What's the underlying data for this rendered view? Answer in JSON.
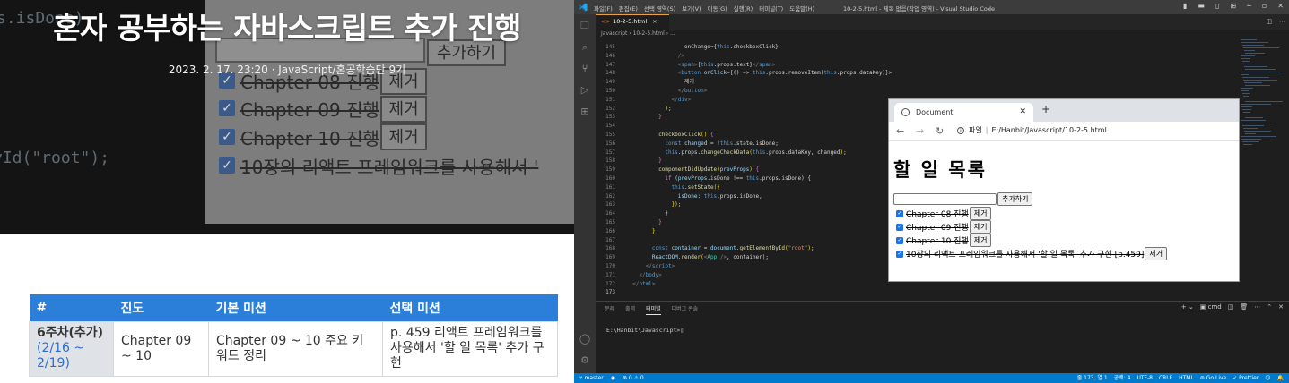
{
  "blog": {
    "title": "혼자 공부하는 자바스크립트 추가 진행",
    "meta": "2023. 2. 17. 23:20 · JavaScript/혼공학습단 9기",
    "hero_bg": {
      "code_line1": "s.isDone)",
      "code_line2": "yId(\"root\");",
      "add_button": "추가하기",
      "remove_button": "제거",
      "items": [
        "Chapter 08 진행",
        "Chapter 09 진행",
        "Chapter 10 진행",
        "10장의 리액트 프레임워크를 사용해서 '"
      ]
    },
    "table": {
      "headers": [
        "#",
        "진도",
        "기본 미션",
        "선택 미션"
      ],
      "row": {
        "week": "6주차(추가)",
        "dates": "(2/16 ~ 2/19)",
        "progress": "Chapter 09 ~ 10",
        "basic_mission": "Chapter 09 ~ 10 주요 키워드 정리",
        "optional_mission": "p. 459 리액트 프레임워크를 사용해서 '할 일 목록' 추가 구현"
      }
    }
  },
  "vscode": {
    "menu": [
      "파일(F)",
      "편집(E)",
      "선택 영역(S)",
      "보기(V)",
      "이동(G)",
      "실행(R)",
      "터미널(T)",
      "도움말(H)"
    ],
    "window_title": "10-2-5.html - 제목 없음(작업 영역) - Visual Studio Code",
    "tab": {
      "label": "10-2-5.html",
      "close": "×"
    },
    "breadcrumb": "Javascript  ›  10-2-5.html  ›  ...",
    "code_lines": [
      {
        "n": "145",
        "segs": [
          [
            "p",
            "                  onChange={"
          ],
          [
            "k",
            "this"
          ],
          [
            "p",
            ".checkboxClick}"
          ]
        ]
      },
      {
        "n": "146",
        "segs": [
          [
            "gr",
            "                />"
          ]
        ]
      },
      {
        "n": "147",
        "segs": [
          [
            "gr",
            "                <"
          ],
          [
            "tg",
            "span"
          ],
          [
            "gr",
            ">"
          ],
          [
            "p",
            "{"
          ],
          [
            "k",
            "this"
          ],
          [
            "p",
            ".props.text}"
          ],
          [
            "gr",
            "</"
          ],
          [
            "tg",
            "span"
          ],
          [
            "gr",
            ">"
          ]
        ]
      },
      {
        "n": "148",
        "segs": [
          [
            "gr",
            "                <"
          ],
          [
            "tg",
            "button"
          ],
          [
            "v",
            " onClick"
          ],
          [
            "p",
            "={() => "
          ],
          [
            "k",
            "this"
          ],
          [
            "p",
            ".props.removeItem("
          ],
          [
            "k",
            "this"
          ],
          [
            "p",
            ".props.dataKey)}>"
          ]
        ]
      },
      {
        "n": "149",
        "segs": [
          [
            "p",
            "                  제거"
          ]
        ]
      },
      {
        "n": "150",
        "segs": [
          [
            "gr",
            "                </"
          ],
          [
            "tg",
            "button"
          ],
          [
            "gr",
            ">"
          ]
        ]
      },
      {
        "n": "151",
        "segs": [
          [
            "gr",
            "              </"
          ],
          [
            "tg",
            "div"
          ],
          [
            "gr",
            ">"
          ]
        ]
      },
      {
        "n": "152",
        "segs": [
          [
            "b",
            "            )"
          ],
          [
            "p",
            ";"
          ]
        ]
      },
      {
        "n": "153",
        "segs": [
          [
            "bb",
            "          }"
          ]
        ]
      },
      {
        "n": "154",
        "segs": [
          [
            "p",
            ""
          ]
        ]
      },
      {
        "n": "155",
        "segs": [
          [
            "f",
            "          checkboxClick"
          ],
          [
            "b",
            "()"
          ],
          [
            "p",
            " "
          ],
          [
            "bb",
            "{"
          ]
        ]
      },
      {
        "n": "156",
        "segs": [
          [
            "k",
            "            const"
          ],
          [
            "v",
            " changed"
          ],
          [
            "p",
            " = !"
          ],
          [
            "k",
            "this"
          ],
          [
            "p",
            ".state.isDone;"
          ]
        ]
      },
      {
        "n": "157",
        "segs": [
          [
            "k",
            "            this"
          ],
          [
            "p",
            ".props."
          ],
          [
            "f",
            "changeCheckData"
          ],
          [
            "b",
            "("
          ],
          [
            "k",
            "this"
          ],
          [
            "p",
            ".props.dataKey, changed"
          ],
          [
            "b",
            ")"
          ],
          [
            "p",
            ";"
          ]
        ]
      },
      {
        "n": "158",
        "segs": [
          [
            "bb",
            "          }"
          ]
        ]
      },
      {
        "n": "159",
        "segs": [
          [
            "f",
            "          componentDidUpdate"
          ],
          [
            "b",
            "("
          ],
          [
            "v",
            "prevProps"
          ],
          [
            "b",
            ")"
          ],
          [
            "p",
            " "
          ],
          [
            "bb",
            "{"
          ]
        ]
      },
      {
        "n": "160",
        "segs": [
          [
            "c",
            "            if"
          ],
          [
            "p",
            " ("
          ],
          [
            "v",
            "prevProps"
          ],
          [
            "p",
            ".isDone !== "
          ],
          [
            "k",
            "this"
          ],
          [
            "p",
            ".props.isDone) {"
          ]
        ]
      },
      {
        "n": "161",
        "segs": [
          [
            "k",
            "              this"
          ],
          [
            "p",
            "."
          ],
          [
            "f",
            "setState"
          ],
          [
            "b",
            "({"
          ]
        ]
      },
      {
        "n": "162",
        "segs": [
          [
            "v",
            "                isDone"
          ],
          [
            "p",
            ": "
          ],
          [
            "k",
            "this"
          ],
          [
            "p",
            ".props.isDone,"
          ]
        ]
      },
      {
        "n": "163",
        "segs": [
          [
            "b",
            "              })"
          ],
          [
            "p",
            ";"
          ]
        ]
      },
      {
        "n": "164",
        "segs": [
          [
            "p",
            "            }"
          ]
        ]
      },
      {
        "n": "165",
        "segs": [
          [
            "bb",
            "          }"
          ]
        ]
      },
      {
        "n": "166",
        "segs": [
          [
            "b",
            "        }"
          ]
        ]
      },
      {
        "n": "167",
        "segs": [
          [
            "p",
            ""
          ]
        ]
      },
      {
        "n": "168",
        "segs": [
          [
            "k",
            "        const"
          ],
          [
            "v",
            " container"
          ],
          [
            "p",
            " = "
          ],
          [
            "v",
            "document"
          ],
          [
            "p",
            "."
          ],
          [
            "f",
            "getElementById"
          ],
          [
            "b",
            "("
          ],
          [
            "s",
            "\"root\""
          ],
          [
            "b",
            ")"
          ],
          [
            "p",
            ";"
          ]
        ]
      },
      {
        "n": "169",
        "segs": [
          [
            "v",
            "        ReactDOM"
          ],
          [
            "p",
            "."
          ],
          [
            "f",
            "render"
          ],
          [
            "b",
            "("
          ],
          [
            "gr",
            "<"
          ],
          [
            "t",
            "App"
          ],
          [
            "gr",
            " />"
          ],
          [
            "p",
            ", container"
          ],
          [
            "b",
            ")"
          ],
          [
            "p",
            ";"
          ]
        ]
      },
      {
        "n": "170",
        "segs": [
          [
            "gr",
            "      </"
          ],
          [
            "tg",
            "script"
          ],
          [
            "gr",
            ">"
          ]
        ]
      },
      {
        "n": "171",
        "segs": [
          [
            "gr",
            "    </"
          ],
          [
            "tg",
            "body"
          ],
          [
            "gr",
            ">"
          ]
        ]
      },
      {
        "n": "172",
        "segs": [
          [
            "gr",
            "  </"
          ],
          [
            "tg",
            "html"
          ],
          [
            "gr",
            ">"
          ]
        ]
      },
      {
        "n": "173",
        "segs": [
          [
            "p",
            ""
          ]
        ]
      }
    ],
    "panel": {
      "tabs": [
        "문제",
        "출력",
        "터미널",
        "디버그 콘솔"
      ],
      "active_tab": 2,
      "shell": "cmd",
      "terminal_text": "E:\\Hanbit\\Javascript>"
    },
    "status": {
      "branch": "master",
      "errors": "⊗ 0  ⚠ 0",
      "position": "줄 173, 열 1",
      "spaces": "공백: 4",
      "encoding": "UTF-8",
      "eol": "CRLF",
      "language": "HTML",
      "golive": "Go Live",
      "prettier": "✓ Prettier"
    }
  },
  "browser": {
    "tab_title": "Document",
    "url_scheme": "파일",
    "url_path": "E:/Hanbit/Javascript/10-2-5.html",
    "heading": "할 일 목록",
    "add_button": "추가하기",
    "remove_button": "제거",
    "items": [
      "Chapter 08 진행",
      "Chapter 09 진행",
      "Chapter 10 진행",
      "10장의 리액트 프레임워크를 사용해서 '할 일 목록' 추가 구현 [p.459]"
    ]
  },
  "colors": {
    "table_header": "#2b7fd8",
    "vscode_status": "#007acc",
    "checkbox": "#1a73e8"
  }
}
